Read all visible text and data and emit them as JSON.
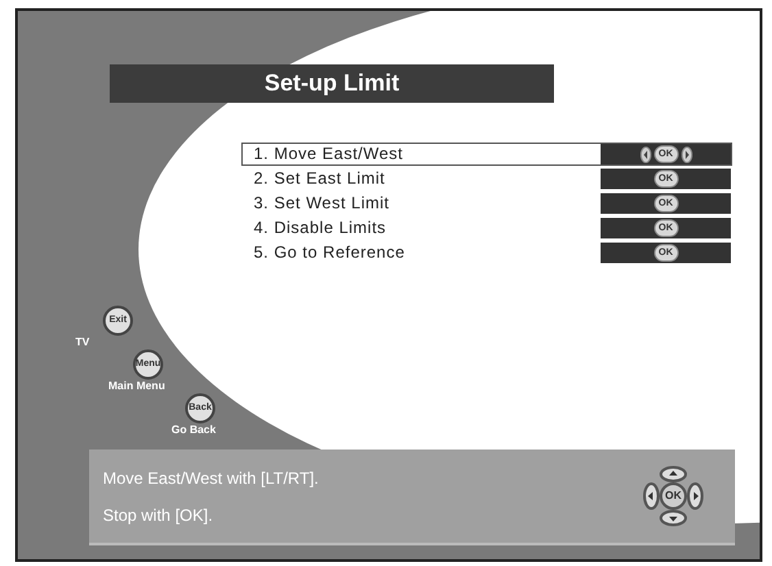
{
  "title": "Set-up Limit",
  "menu": [
    {
      "label": "1. Move East/West",
      "selected": true,
      "kind": "arrows_ok",
      "key": "OK"
    },
    {
      "label": "2. Set East Limit",
      "selected": false,
      "kind": "ok",
      "key": "OK"
    },
    {
      "label": "3. Set West Limit",
      "selected": false,
      "kind": "ok",
      "key": "OK"
    },
    {
      "label": "4. Disable Limits",
      "selected": false,
      "kind": "ok",
      "key": "OK"
    },
    {
      "label": "5. Go to Reference",
      "selected": false,
      "kind": "ok",
      "key": "OK"
    }
  ],
  "remote_keys": [
    {
      "key": "Exit",
      "action": "TV"
    },
    {
      "key": "Menu",
      "action": "Main Menu"
    },
    {
      "key": "Back",
      "action": "Go Back"
    }
  ],
  "hint": {
    "lines": [
      "Move East/West with [LT/RT].",
      "Stop with [OK]."
    ],
    "dpad_key": "OK"
  }
}
